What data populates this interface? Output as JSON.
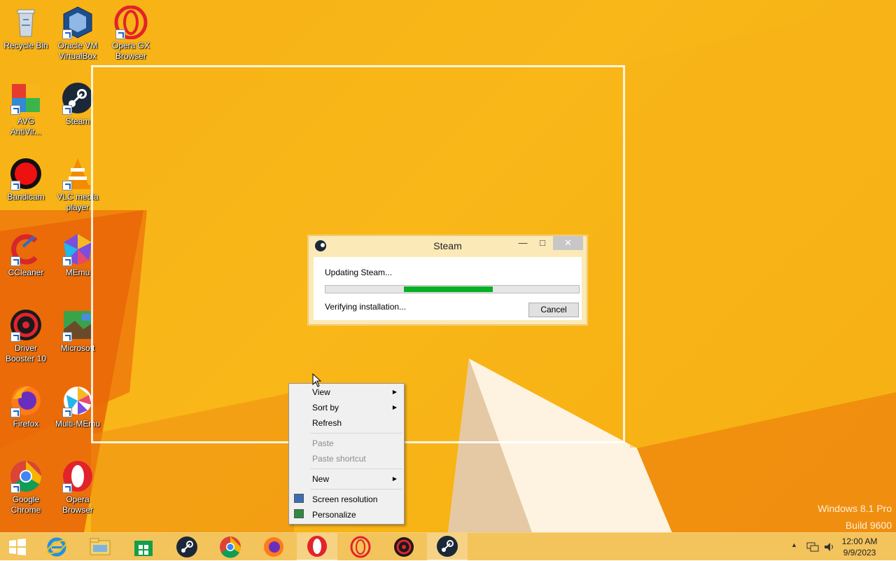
{
  "desktop": {
    "icons": [
      {
        "label": "Recycle Bin",
        "icon": "recycle-bin-icon"
      },
      {
        "label": "Oracle VM\nVirtualBox",
        "icon": "virtualbox-icon"
      },
      {
        "label": "Opera GX\nBrowser",
        "icon": "opera-gx-icon"
      },
      {
        "label": "AVG\nAntiVir...",
        "icon": "avg-icon"
      },
      {
        "label": "Steam",
        "icon": "steam-icon"
      },
      {
        "label": "Bandicam",
        "icon": "bandicam-icon"
      },
      {
        "label": "VLC media\nplayer",
        "icon": "vlc-icon"
      },
      {
        "label": "CCleaner",
        "icon": "ccleaner-icon"
      },
      {
        "label": "MEmu",
        "icon": "memu-icon"
      },
      {
        "label": "Driver\nBooster 10",
        "icon": "driver-booster-icon"
      },
      {
        "label": "Microsoft",
        "icon": "microsoft-icon"
      },
      {
        "label": "Firefox",
        "icon": "firefox-icon"
      },
      {
        "label": "Multi-MEmu",
        "icon": "multi-memu-icon"
      },
      {
        "label": "Google\nChrome",
        "icon": "chrome-icon"
      },
      {
        "label": "Opera\nBrowser",
        "icon": "opera-icon"
      }
    ]
  },
  "steam_dialog": {
    "title": "Steam",
    "status": "Updating Steam...",
    "substatus": "Verifying installation...",
    "progress_start": 0.31,
    "progress_end": 0.66,
    "cancel_label": "Cancel",
    "minimize_glyph": "—",
    "maximize_glyph": "□",
    "close_glyph": "✕"
  },
  "context_menu": {
    "items": [
      {
        "label": "View",
        "disabled": false,
        "submenu": true
      },
      {
        "label": "Sort by",
        "disabled": false,
        "submenu": true
      },
      {
        "label": "Refresh",
        "disabled": false,
        "submenu": false
      },
      {
        "label": "Paste",
        "disabled": true,
        "submenu": false
      },
      {
        "label": "Paste shortcut",
        "disabled": true,
        "submenu": false
      },
      {
        "label": "New",
        "disabled": false,
        "submenu": true
      },
      {
        "label": "Screen resolution",
        "disabled": false,
        "submenu": false,
        "icon": "screen-resolution-icon"
      },
      {
        "label": "Personalize",
        "disabled": false,
        "submenu": false,
        "icon": "personalize-icon"
      }
    ],
    "submenu_glyph": "▶"
  },
  "watermark": {
    "line1": "Windows 8.1 Pro",
    "line2": "Build 9600"
  },
  "taskbar": {
    "items": [
      {
        "name": "start-button",
        "icon": "windows-logo-icon"
      },
      {
        "name": "internet-explorer",
        "icon": "ie-icon"
      },
      {
        "name": "file-explorer",
        "icon": "folder-icon"
      },
      {
        "name": "store",
        "icon": "store-icon"
      },
      {
        "name": "steam",
        "icon": "steam-icon"
      },
      {
        "name": "chrome",
        "icon": "chrome-icon"
      },
      {
        "name": "firefox",
        "icon": "firefox-icon"
      },
      {
        "name": "opera",
        "icon": "opera-icon",
        "active": true
      },
      {
        "name": "opera-gx",
        "icon": "opera-gx-icon"
      },
      {
        "name": "driver-booster",
        "icon": "driver-booster-icon"
      },
      {
        "name": "steam-running",
        "icon": "steam-icon",
        "active": true
      }
    ],
    "clock_time": "12:00 AM",
    "clock_date": "9/9/2023",
    "tray_arrow": "▲"
  },
  "colors": {
    "wallpaper": "#f7b215",
    "progress_fill": "#06b025",
    "accent_orange": "#ec6a07"
  }
}
